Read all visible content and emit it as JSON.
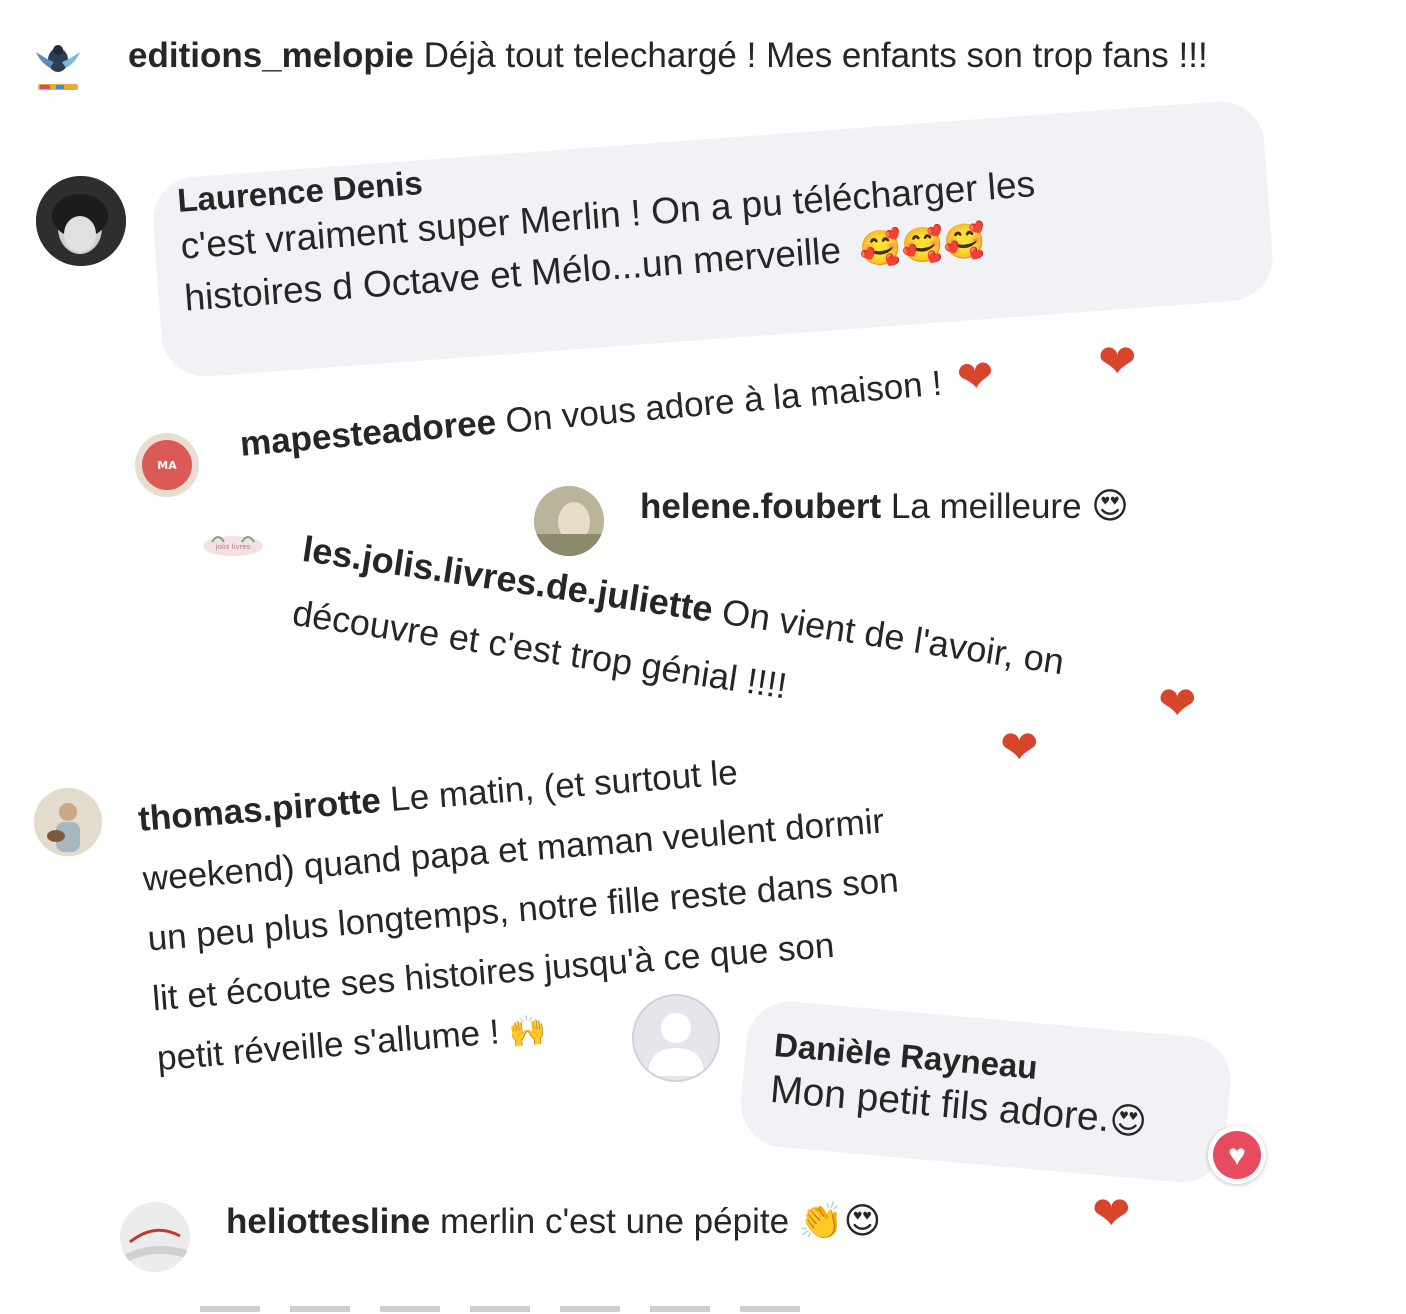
{
  "comments": [
    {
      "user": "editions_melopie",
      "text": "Déjà tout telechargé ! Mes enfants son trop fans !!!"
    },
    {
      "user": "Laurence Denis",
      "line1": "c'est vraiment super Merlin ! On a pu télécharger les",
      "line2": "histoires d Octave et Mélo...un merveille",
      "emoji": "🥰🥰🥰"
    },
    {
      "user": "mapesteadoree",
      "text": "On vous adore à la maison !",
      "emoji": "❤️"
    },
    {
      "user": "helene.foubert",
      "text": "La meilleure",
      "emoji": "😍"
    },
    {
      "user": "les.jolis.livres.de.juliette",
      "text": "On vient de l'avoir, on",
      "line2": "découvre et c'est trop génial !!!!"
    },
    {
      "user": "thomas.pirotte",
      "line1": "Le matin, (et surtout le",
      "line2": "weekend) quand papa et maman veulent dormir",
      "line3": "un peu plus longtemps, notre fille reste dans son",
      "line4": "lit et écoute ses histoires jusqu'à ce que son",
      "line5": "petit réveille s'allume !",
      "emoji": "🙌"
    },
    {
      "user": "Danièle Rayneau",
      "text": "Mon petit fils adore.",
      "emoji": "😍"
    },
    {
      "user": "heliottesline",
      "text": "merlin c'est une pépite",
      "emoji": "👏😍"
    }
  ],
  "icons": {
    "heart": "heart-icon",
    "like": "like-badge-icon"
  },
  "colors": {
    "heart": "#d7452b",
    "bubble": "#f0f2f5",
    "text": "#262626"
  }
}
